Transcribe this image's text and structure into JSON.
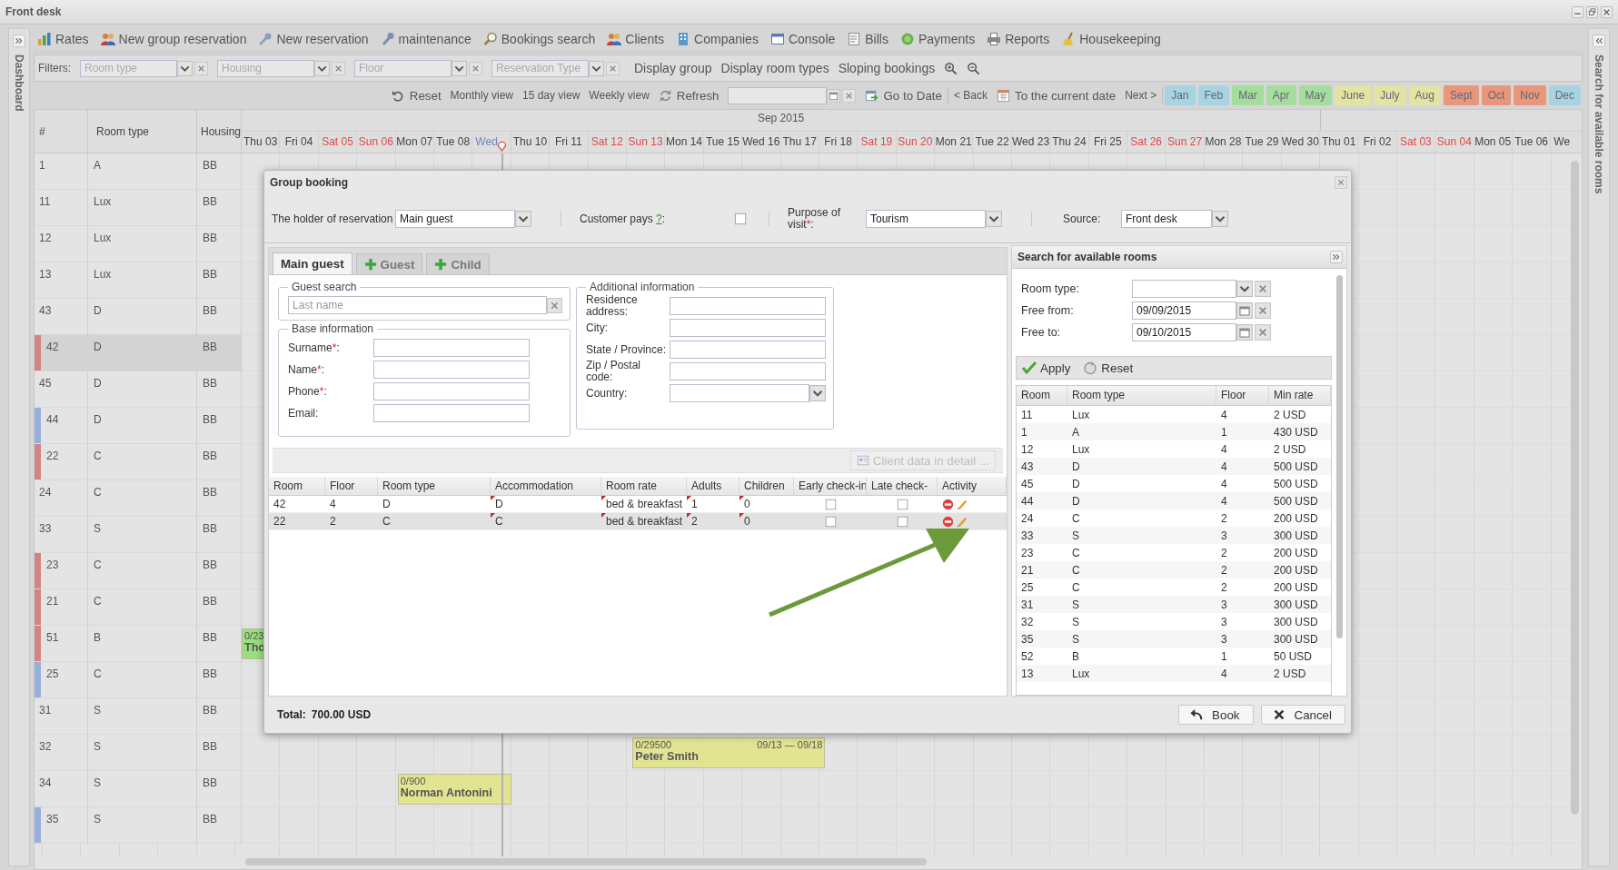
{
  "window": {
    "title": "Front desk"
  },
  "left_panel": {
    "label": "Dashboard"
  },
  "right_panel": {
    "label": "Search for available rooms"
  },
  "toolbar": [
    {
      "label": "Rates"
    },
    {
      "label": "New group reservation"
    },
    {
      "label": "New reservation"
    },
    {
      "label": "maintenance"
    },
    {
      "label": "Bookings search"
    },
    {
      "label": "Clients"
    },
    {
      "label": "Companies"
    },
    {
      "label": "Console"
    },
    {
      "label": "Bills"
    },
    {
      "label": "Payments"
    },
    {
      "label": "Reports"
    },
    {
      "label": "Housekeeping"
    }
  ],
  "filters": {
    "label": "Filters:",
    "combos": [
      {
        "placeholder": "Room type"
      },
      {
        "placeholder": "Housing"
      },
      {
        "placeholder": "Floor"
      },
      {
        "placeholder": "Reservation Type"
      }
    ],
    "links": [
      {
        "label": "Display group"
      },
      {
        "label": "Display room types"
      },
      {
        "label": "Sloping bookings"
      }
    ]
  },
  "nav": {
    "items": [
      {
        "label": "Reset",
        "kind": "undo"
      },
      {
        "label": "Monthly view",
        "kind": "link"
      },
      {
        "label": "15 day view",
        "kind": "link"
      },
      {
        "label": "Weekly view",
        "kind": "link"
      },
      {
        "label": "Refresh",
        "kind": "refresh"
      },
      {
        "kind": "date"
      },
      {
        "label": "Go to Date",
        "kind": "go"
      },
      {
        "label": "< Back",
        "kind": "link",
        "divider_before": true
      },
      {
        "label": "To the current date",
        "kind": "calendar"
      },
      {
        "label": "Next >",
        "kind": "link"
      }
    ],
    "months": [
      {
        "label": "Jan",
        "color": "#a8d3e0"
      },
      {
        "label": "Feb",
        "color": "#a8d3e0"
      },
      {
        "label": "Mar",
        "color": "#a5dd9c"
      },
      {
        "label": "Apr",
        "color": "#a5dd9c"
      },
      {
        "label": "May",
        "color": "#a5dd9c"
      },
      {
        "label": "June",
        "color": "#e3e3a3"
      },
      {
        "label": "July",
        "color": "#e3e3a3"
      },
      {
        "label": "Aug",
        "color": "#e3e3a3"
      },
      {
        "label": "Sept",
        "color": "#e8967c"
      },
      {
        "label": "Oct",
        "color": "#e8967c"
      },
      {
        "label": "Nov",
        "color": "#e8967c"
      },
      {
        "label": "Dec",
        "color": "#a8d3e0"
      }
    ]
  },
  "grid": {
    "columns": [
      "#",
      "Room type",
      "Housing"
    ],
    "month": "Sep 2015",
    "days": [
      {
        "label": "Thu 03",
        "kind": "weekday"
      },
      {
        "label": "Fri 04",
        "kind": "weekday"
      },
      {
        "label": "Sat 05",
        "kind": "weekend"
      },
      {
        "label": "Sun 06",
        "kind": "weekend"
      },
      {
        "label": "Mon 07",
        "kind": "weekday"
      },
      {
        "label": "Tue 08",
        "kind": "weekday"
      },
      {
        "label": "Wed",
        "kind": "today"
      },
      {
        "label": "Thu 10",
        "kind": "weekday"
      },
      {
        "label": "Fri 11",
        "kind": "weekday"
      },
      {
        "label": "Sat 12",
        "kind": "weekend"
      },
      {
        "label": "Sun 13",
        "kind": "weekend"
      },
      {
        "label": "Mon 14",
        "kind": "weekday"
      },
      {
        "label": "Tue 15",
        "kind": "weekday"
      },
      {
        "label": "Wed 16",
        "kind": "weekday"
      },
      {
        "label": "Thu 17",
        "kind": "weekday"
      },
      {
        "label": "Fri 18",
        "kind": "weekday"
      },
      {
        "label": "Sat 19",
        "kind": "weekend"
      },
      {
        "label": "Sun 20",
        "kind": "weekend"
      },
      {
        "label": "Mon 21",
        "kind": "weekday"
      },
      {
        "label": "Tue 22",
        "kind": "weekday"
      },
      {
        "label": "Wed 23",
        "kind": "weekday"
      },
      {
        "label": "Thu 24",
        "kind": "weekday"
      },
      {
        "label": "Fri 25",
        "kind": "weekday"
      },
      {
        "label": "Sat 26",
        "kind": "weekend"
      },
      {
        "label": "Sun 27",
        "kind": "weekend"
      },
      {
        "label": "Mon 28",
        "kind": "weekday"
      },
      {
        "label": "Tue 29",
        "kind": "weekday"
      },
      {
        "label": "Wed 30",
        "kind": "weekday"
      },
      {
        "label": "Thu 01",
        "kind": "weekday"
      },
      {
        "label": "Fri 02",
        "kind": "weekday"
      },
      {
        "label": "Sat 03",
        "kind": "weekend"
      },
      {
        "label": "Sun 04",
        "kind": "weekend"
      },
      {
        "label": "Mon 05",
        "kind": "weekday"
      },
      {
        "label": "Tue 06",
        "kind": "weekday"
      },
      {
        "label": "We",
        "kind": "weekday"
      }
    ],
    "rows": [
      {
        "number": "1",
        "room_type": "A",
        "housing": "BB",
        "selected": false
      },
      {
        "number": "11",
        "room_type": "Lux",
        "housing": "BB",
        "selected": false
      },
      {
        "number": "12",
        "room_type": "Lux",
        "housing": "BB",
        "selected": false
      },
      {
        "number": "13",
        "room_type": "Lux",
        "housing": "BB",
        "selected": false
      },
      {
        "number": "43",
        "room_type": "D",
        "housing": "BB",
        "selected": false
      },
      {
        "number": "42",
        "room_type": "D",
        "housing": "BB",
        "selected": true,
        "color": "#d08484"
      },
      {
        "number": "45",
        "room_type": "D",
        "housing": "BB",
        "selected": false
      },
      {
        "number": "44",
        "room_type": "D",
        "housing": "BB",
        "selected": false,
        "color": "#98b0dc"
      },
      {
        "number": "22",
        "room_type": "C",
        "housing": "BB",
        "selected": false,
        "color": "#d08484"
      },
      {
        "number": "24",
        "room_type": "C",
        "housing": "BB",
        "selected": false
      },
      {
        "number": "33",
        "room_type": "S",
        "housing": "BB",
        "selected": false
      },
      {
        "number": "23",
        "room_type": "C",
        "housing": "BB",
        "selected": false,
        "color": "#d08484"
      },
      {
        "number": "21",
        "room_type": "C",
        "housing": "BB",
        "selected": false,
        "color": "#d08484"
      },
      {
        "number": "51",
        "room_type": "B",
        "housing": "BB",
        "selected": false,
        "color": "#d08484",
        "booking": {
          "amount": "0/23",
          "guest": "Tho",
          "color": "#98e07e"
        }
      },
      {
        "number": "25",
        "room_type": "C",
        "housing": "BB",
        "selected": false,
        "color": "#98b0dc"
      },
      {
        "number": "31",
        "room_type": "S",
        "housing": "BB",
        "selected": false
      },
      {
        "number": "32",
        "room_type": "S",
        "housing": "BB",
        "selected": false,
        "booking": {
          "amount": "0/29500",
          "dates": "09/13 — 09/18",
          "guest": "Peter Smith",
          "color": "#e2e492"
        }
      },
      {
        "number": "34",
        "room_type": "S",
        "housing": "BB",
        "selected": false,
        "booking": {
          "amount": "0/900",
          "guest": "Norman Antonini",
          "color": "#e2e492"
        }
      },
      {
        "number": "35",
        "room_type": "S",
        "housing": "BB",
        "selected": false,
        "color": "#98b0dc"
      }
    ]
  },
  "dialog": {
    "title": "Group booking",
    "holder": {
      "label": "The holder of reservation",
      "value": "Main guest"
    },
    "customer_pays": {
      "label": "Customer pays ",
      "help": "?",
      "after": ":",
      "checked": false
    },
    "purpose": {
      "label": "Purpose of visit",
      "mark": "*",
      "after": ":",
      "value": "Tourism"
    },
    "source": {
      "label": "Source:",
      "value": "Front desk"
    },
    "tabs": [
      {
        "label": "Main guest",
        "kind": "plain",
        "selected": true
      },
      {
        "label": "Guest",
        "kind": "add",
        "selected": false
      },
      {
        "label": "Child",
        "kind": "add",
        "selected": false
      }
    ],
    "guest_search": {
      "legend": "Guest search",
      "placeholder": "Last name"
    },
    "base_info": {
      "legend": "Base information",
      "fields": [
        {
          "label": "Surname",
          "mark": "*",
          "after": ":"
        },
        {
          "label": "Name",
          "mark": "*",
          "after": ":"
        },
        {
          "label": "Phone",
          "mark": "*",
          "after": ":"
        },
        {
          "label": "Email:"
        }
      ]
    },
    "additional_info": {
      "legend": "Additional information",
      "fields": [
        {
          "label": "Residence address:",
          "kind": "text"
        },
        {
          "label": "City:",
          "kind": "text"
        },
        {
          "label": "State / Province:",
          "kind": "text"
        },
        {
          "label": "Zip / Postal code:",
          "kind": "text"
        },
        {
          "label": "Country:",
          "kind": "combo"
        }
      ]
    },
    "client_button": {
      "label": "Client data in detail ...",
      "disabled": true
    },
    "rooms_table": {
      "columns": [
        {
          "label": "Room",
          "kind": "text"
        },
        {
          "label": "Floor",
          "kind": "text"
        },
        {
          "label": "Room type",
          "kind": "text"
        },
        {
          "label": "Accommodation",
          "kind": "edited"
        },
        {
          "label": "Room rate",
          "kind": "edited"
        },
        {
          "label": "Adults",
          "kind": "edited"
        },
        {
          "label": "Children",
          "kind": "edited"
        },
        {
          "label": "Early check-in",
          "kind": "check"
        },
        {
          "label": "Late check-",
          "kind": "check"
        },
        {
          "label": "Activity",
          "kind": "actions"
        }
      ],
      "rows": [
        {
          "selected": false,
          "cells": [
            "42",
            "4",
            "D",
            "D",
            "bed & breakfast",
            "1",
            "0"
          ],
          "checks": [
            {
              "checked": false
            },
            {
              "checked": false
            }
          ]
        },
        {
          "selected": true,
          "cells": [
            "22",
            "2",
            "C",
            "C",
            "bed & breakfast",
            "2",
            "0"
          ],
          "checks": [
            {
              "checked": false
            },
            {
              "checked": false
            }
          ]
        }
      ]
    },
    "total": {
      "label": "Total:",
      "value": "700.00 USD"
    },
    "search_panel": {
      "title": "Search for available rooms",
      "fields": [
        {
          "label": "Room type:",
          "kind": "combo"
        },
        {
          "label": "Free from:",
          "kind": "date",
          "value": "09/09/2015"
        },
        {
          "label": "Free to:",
          "kind": "date",
          "value": "09/10/2015"
        }
      ],
      "buttons": [
        {
          "label": "Apply",
          "kind": "apply"
        },
        {
          "label": "Reset",
          "kind": "reset"
        }
      ],
      "columns": [
        "Room",
        "Room type",
        "Floor",
        "Min rate"
      ],
      "rows": [
        [
          "11",
          "Lux",
          "4",
          "2 USD"
        ],
        [
          "1",
          "A",
          "1",
          "430 USD"
        ],
        [
          "12",
          "Lux",
          "4",
          "2 USD"
        ],
        [
          "43",
          "D",
          "4",
          "500 USD"
        ],
        [
          "45",
          "D",
          "4",
          "500 USD"
        ],
        [
          "44",
          "D",
          "4",
          "500 USD"
        ],
        [
          "24",
          "C",
          "2",
          "200 USD"
        ],
        [
          "33",
          "S",
          "3",
          "300 USD"
        ],
        [
          "23",
          "C",
          "2",
          "200 USD"
        ],
        [
          "21",
          "C",
          "2",
          "200 USD"
        ],
        [
          "25",
          "C",
          "2",
          "200 USD"
        ],
        [
          "31",
          "S",
          "3",
          "300 USD"
        ],
        [
          "32",
          "S",
          "3",
          "300 USD"
        ],
        [
          "35",
          "S",
          "3",
          "300 USD"
        ],
        [
          "52",
          "B",
          "1",
          "50 USD"
        ],
        [
          "13",
          "Lux",
          "4",
          "2 USD"
        ]
      ]
    },
    "buttons": [
      {
        "label": "Book",
        "kind": "book"
      },
      {
        "label": "Cancel",
        "kind": "cancel"
      }
    ]
  }
}
